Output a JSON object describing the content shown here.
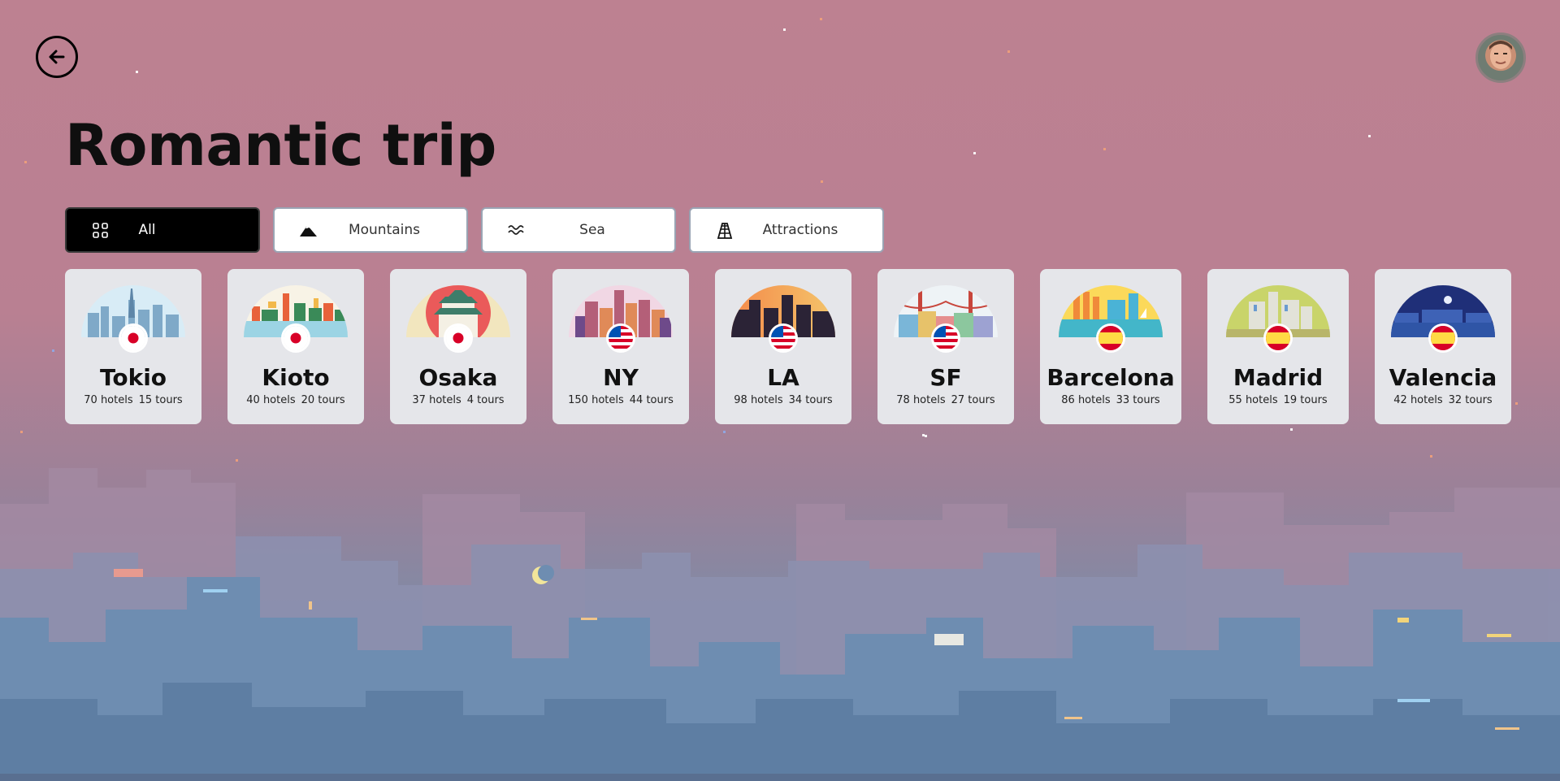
{
  "header": {
    "title": "Romantic trip",
    "back_icon": "arrow-left-circle-icon",
    "avatar": "user-avatar"
  },
  "filters": [
    {
      "label": "All",
      "icon": "grid-icon",
      "active": true
    },
    {
      "label": "Mountains",
      "icon": "mountain-icon",
      "active": false
    },
    {
      "label": "Sea",
      "icon": "waves-icon",
      "active": false
    },
    {
      "label": "Attractions",
      "icon": "pyramid-icon",
      "active": false
    }
  ],
  "destinations": [
    {
      "city": "Tokio",
      "hotels": "70 hotels",
      "tours": "15 tours",
      "flag": "japan-flag-icon"
    },
    {
      "city": "Kioto",
      "hotels": "40 hotels",
      "tours": "20 tours",
      "flag": "japan-flag-icon"
    },
    {
      "city": "Osaka",
      "hotels": "37 hotels",
      "tours": "4 tours",
      "flag": "japan-flag-icon"
    },
    {
      "city": "NY",
      "hotels": "150 hotels",
      "tours": "44 tours",
      "flag": "usa-flag-icon"
    },
    {
      "city": "LA",
      "hotels": "98 hotels",
      "tours": "34 tours",
      "flag": "usa-flag-icon"
    },
    {
      "city": "SF",
      "hotels": "78 hotels",
      "tours": "27 tours",
      "flag": "usa-flag-icon"
    },
    {
      "city": "Barcelona",
      "hotels": "86 hotels",
      "tours": "33 tours",
      "flag": "spain-flag-icon"
    },
    {
      "city": "Madrid",
      "hotels": "55 hotels",
      "tours": "19 tours",
      "flag": "spain-flag-icon"
    },
    {
      "city": "Valencia",
      "hotels": "42 hotels",
      "tours": "32 tours",
      "flag": "spain-flag-icon"
    }
  ],
  "colors": {
    "sky_top": "#bd8191",
    "skyline": "#6f8fb0",
    "card_bg": "#e5e6ea",
    "active_tab": "#000000"
  }
}
